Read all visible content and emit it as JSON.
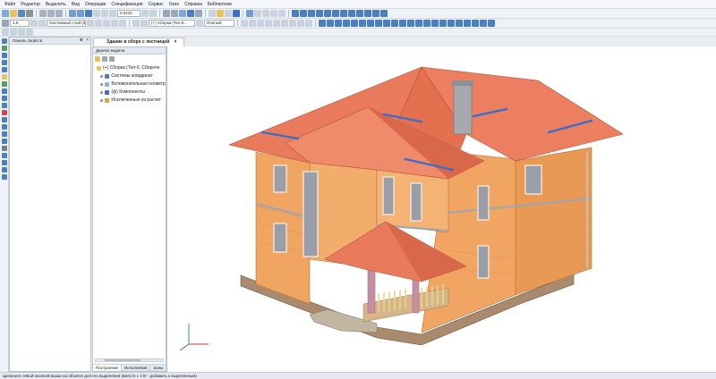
{
  "menu": [
    "Файл",
    "Редактор",
    "Выделить",
    "Вид",
    "Операции",
    "Спецификация",
    "Сервис",
    "Окно",
    "Справка",
    "Библиотеки"
  ],
  "toolbar": {
    "line_width": "1.0",
    "layer_combo": "Системный слой (0)",
    "model_combo": "(+) Сборка (Тел.0...",
    "display_mode": "Полный",
    "scale_value": "0.0142"
  },
  "left_panel": {
    "title": "Панель свойств"
  },
  "tree_panel": {
    "title": "Дерево модели",
    "items": [
      {
        "label": "(+) Сборка (Тел-0, Сборочн",
        "icon": "assembly-icon"
      },
      {
        "label": "Системы координат",
        "icon": "coordinate-system-icon"
      },
      {
        "label": "Вспомогательная геометр",
        "icon": "auxiliary-geometry-icon"
      },
      {
        "label": "(ф) Компоненты",
        "icon": "components-icon"
      },
      {
        "label": "Исключенные из расчет",
        "icon": "excluded-icon"
      }
    ],
    "bottom_tabs": [
      "Построение",
      "Исполнения",
      "Зоны"
    ]
  },
  "document_tab": {
    "title": "Здание в сборе с лестницей"
  },
  "status_bar": {
    "text": "Щелкните левой кнопкой мыши на объекте для его выделения (вместе с Ctrl - добавить к выделенным)"
  },
  "colors": {
    "roof": "#ea7a5c",
    "roof_dark": "#c85a40",
    "wall": "#f2ad6c",
    "wall_dark": "#e0964f",
    "base": "#a98a6c",
    "window_glass": "#9a9ea8",
    "accent_blue": "#3b6dc9"
  }
}
